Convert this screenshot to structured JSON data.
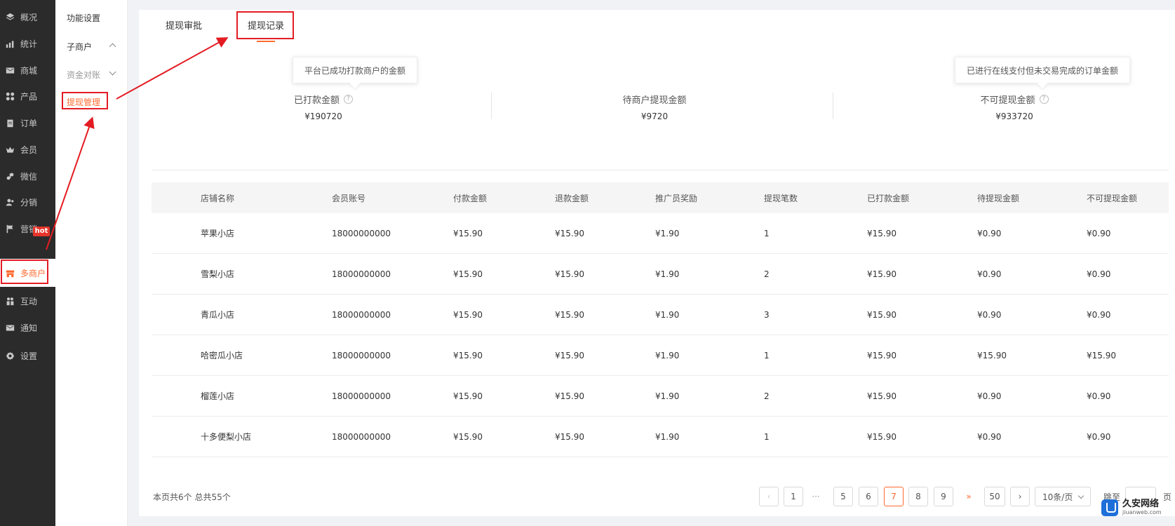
{
  "sidebar": {
    "items": [
      {
        "label": "概况",
        "icon": "layers-icon"
      },
      {
        "label": "统计",
        "icon": "chart-icon"
      },
      {
        "label": "商城",
        "icon": "mail-icon"
      },
      {
        "label": "产品",
        "icon": "grid-icon"
      },
      {
        "label": "订单",
        "icon": "clipboard-icon"
      },
      {
        "label": "会员",
        "icon": "crown-icon"
      },
      {
        "label": "微信",
        "icon": "wechat-icon"
      },
      {
        "label": "分销",
        "icon": "users-icon"
      },
      {
        "label": "营销",
        "icon": "flag-icon"
      },
      {
        "label": "多商户",
        "icon": "store-icon"
      },
      {
        "label": "互动",
        "icon": "people-icon"
      },
      {
        "label": "通知",
        "icon": "envelope-icon"
      },
      {
        "label": "设置",
        "icon": "gear-icon"
      }
    ],
    "hot_badge": "hot",
    "active_color": "#ff6a2f"
  },
  "subnav": {
    "func_settings": "功能设置",
    "sub_merchant": "子商户",
    "fund_reconcile": "资金对账",
    "withdraw_manage": "提现管理"
  },
  "tabs": {
    "approval": "提现审批",
    "records": "提现记录"
  },
  "stats": {
    "paid": {
      "label": "已打款金额",
      "value": "¥190720"
    },
    "pending": {
      "label": "待商户提现金额",
      "value": "¥9720"
    },
    "unavailable": {
      "label": "不可提现金额",
      "value": "¥933720"
    }
  },
  "tooltips": {
    "paid": "平台已成功打款商户的金额",
    "unavailable": "已进行在线支付但未交易完成的订单金额"
  },
  "table": {
    "headers": [
      "店铺名称",
      "会员账号",
      "付款金额",
      "退款金额",
      "推广员奖励",
      "提现笔数",
      "已打款金额",
      "待提现金额",
      "不可提现金额"
    ],
    "rows": [
      [
        "苹果小店",
        "18000000000",
        "¥15.90",
        "¥15.90",
        "¥1.90",
        "1",
        "¥15.90",
        "¥0.90",
        "¥0.90"
      ],
      [
        "雪梨小店",
        "18000000000",
        "¥15.90",
        "¥15.90",
        "¥1.90",
        "2",
        "¥15.90",
        "¥0.90",
        "¥0.90"
      ],
      [
        "青瓜小店",
        "18000000000",
        "¥15.90",
        "¥15.90",
        "¥1.90",
        "3",
        "¥15.90",
        "¥0.90",
        "¥0.90"
      ],
      [
        "哈密瓜小店",
        "18000000000",
        "¥15.90",
        "¥15.90",
        "¥1.90",
        "1",
        "¥15.90",
        "¥15.90",
        "¥15.90"
      ],
      [
        "榴莲小店",
        "18000000000",
        "¥15.90",
        "¥15.90",
        "¥1.90",
        "2",
        "¥15.90",
        "¥0.90",
        "¥0.90"
      ],
      [
        "十多便梨小店",
        "18000000000",
        "¥15.90",
        "¥15.90",
        "¥1.90",
        "1",
        "¥15.90",
        "¥0.90",
        "¥0.90"
      ]
    ]
  },
  "pagination": {
    "info": "本页共6个  总共55个",
    "prev": "‹",
    "pages": [
      "1",
      "···",
      "5",
      "6",
      "7",
      "8",
      "9",
      "»",
      "50"
    ],
    "current": "7",
    "next": "›",
    "page_size": "10条/页",
    "jump_label": "跳至",
    "page_unit": "页"
  },
  "watermark": {
    "main": "久安网络",
    "sub": "jiuanweb.com"
  }
}
